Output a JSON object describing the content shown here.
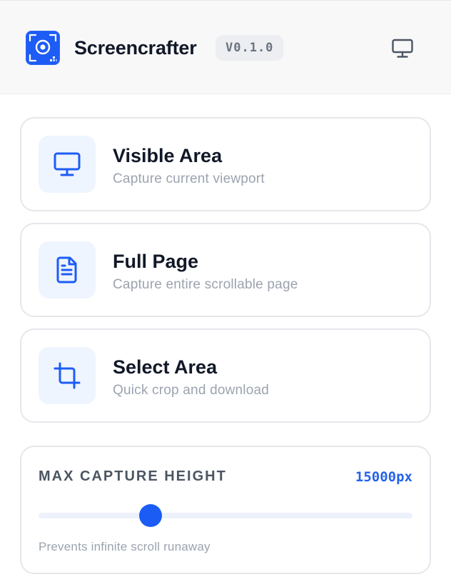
{
  "header": {
    "app_title": "Screencrafter",
    "version": "V0.1.0",
    "logo_icon": "camera-focus-icon",
    "action_icon": "monitor-icon"
  },
  "modes": [
    {
      "title": "Visible Area",
      "subtitle": "Capture current viewport",
      "icon": "monitor-icon"
    },
    {
      "title": "Full Page",
      "subtitle": "Capture entire scrollable page",
      "icon": "document-icon"
    },
    {
      "title": "Select Area",
      "subtitle": "Quick crop and download",
      "icon": "crop-icon"
    }
  ],
  "settings": {
    "label": "MAX CAPTURE HEIGHT",
    "value_text": "15000px",
    "slider_fraction": 0.3,
    "hint": "Prevents infinite scroll runaway"
  },
  "colors": {
    "accent": "#1d5cf5",
    "icon_tile_bg": "#eef5ff",
    "value_text": "#2563eb"
  }
}
